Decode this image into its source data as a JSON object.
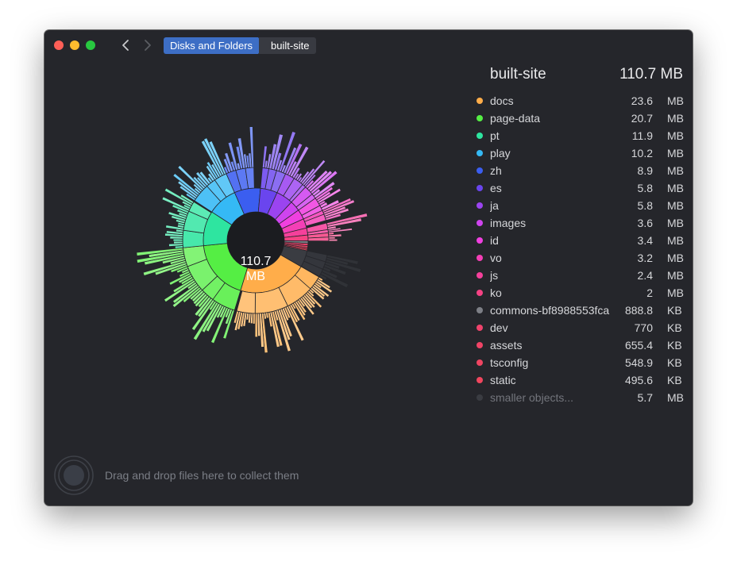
{
  "window": {
    "breadcrumb": [
      "Disks and Folders",
      "built-site"
    ]
  },
  "chart": {
    "center_value": "110.7",
    "center_unit": "MB"
  },
  "panel": {
    "title": "built-site",
    "total": "110.7 MB",
    "items": [
      {
        "name": "docs",
        "value": "23.6",
        "unit": "MB",
        "color": "#ffad4a"
      },
      {
        "name": "page-data",
        "value": "20.7",
        "unit": "MB",
        "color": "#55ee44"
      },
      {
        "name": "pt",
        "value": "11.9",
        "unit": "MB",
        "color": "#2ee5a0"
      },
      {
        "name": "play",
        "value": "10.2",
        "unit": "MB",
        "color": "#35b9f5"
      },
      {
        "name": "zh",
        "value": "8.9",
        "unit": "MB",
        "color": "#3b5ef0"
      },
      {
        "name": "es",
        "value": "5.8",
        "unit": "MB",
        "color": "#6a45ee"
      },
      {
        "name": "ja",
        "value": "5.8",
        "unit": "MB",
        "color": "#9b44f0"
      },
      {
        "name": "images",
        "value": "3.6",
        "unit": "MB",
        "color": "#cf44ef"
      },
      {
        "name": "id",
        "value": "3.4",
        "unit": "MB",
        "color": "#f040e0"
      },
      {
        "name": "vo",
        "value": "3.2",
        "unit": "MB",
        "color": "#f43fb6"
      },
      {
        "name": "js",
        "value": "2.4",
        "unit": "MB",
        "color": "#f5409b"
      },
      {
        "name": "ko",
        "value": "2",
        "unit": "MB",
        "color": "#f54284"
      },
      {
        "name": "commons-bf8988553fca",
        "value": "888.8",
        "unit": "KB",
        "color": "#7d7f86"
      },
      {
        "name": "dev",
        "value": "770",
        "unit": "KB",
        "color": "#f0436c"
      },
      {
        "name": "assets",
        "value": "655.4",
        "unit": "KB",
        "color": "#f04466"
      },
      {
        "name": "tsconfig",
        "value": "548.9",
        "unit": "KB",
        "color": "#f04562"
      },
      {
        "name": "static",
        "value": "495.6",
        "unit": "KB",
        "color": "#f0465e"
      },
      {
        "name": "smaller objects...",
        "value": "5.7",
        "unit": "MB",
        "color": "#3a3c42",
        "dim": true
      }
    ]
  },
  "footer": {
    "drop_text": "Drag and drop files here to collect them"
  }
}
